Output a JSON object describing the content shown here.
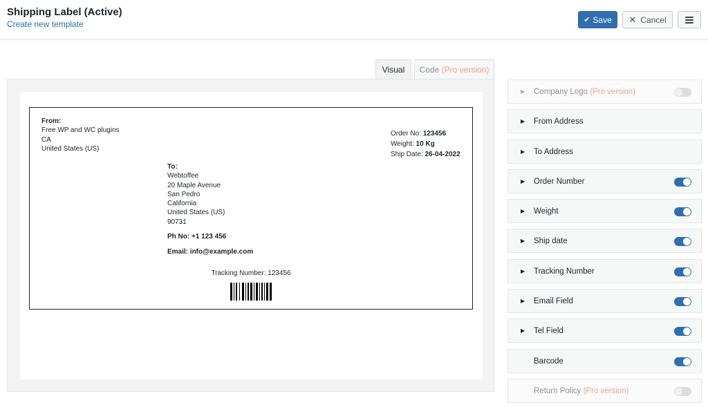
{
  "header": {
    "title": "Shipping Label (Active)",
    "create_link": "Create new template",
    "save_label": "Save",
    "cancel_label": "Cancel"
  },
  "tabs": {
    "visual": "Visual",
    "code": "Code",
    "code_pro": "(Pro version)"
  },
  "label": {
    "from_heading": "From:",
    "from_lines": [
      "Free WP and WC plugins",
      "CA",
      "United States (US)"
    ],
    "order_no_label": "Order No:",
    "order_no": "123456",
    "weight_label": "Weight:",
    "weight": "10 Kg",
    "ship_date_label": "Ship Date:",
    "ship_date": "26-04-2022",
    "to_heading": "To:",
    "to_lines": [
      "Webtoffee",
      "20 Maple Avenue",
      "San Pedro",
      "California",
      "United States (US)",
      "90731"
    ],
    "phone": "Ph No: +1 123 456",
    "email": "Email: info@example.com",
    "tracking": "Tracking Number: 123456"
  },
  "fields": [
    {
      "label": "Company Logo",
      "pro": "(Pro version)",
      "disabled": true,
      "arrow": true,
      "toggle": "off"
    },
    {
      "label": "From Address",
      "arrow": true,
      "toggle": "none"
    },
    {
      "label": "To Address",
      "arrow": true,
      "toggle": "none"
    },
    {
      "label": "Order Number",
      "arrow": true,
      "toggle": "on"
    },
    {
      "label": "Weight",
      "arrow": true,
      "toggle": "on"
    },
    {
      "label": "Ship date",
      "arrow": true,
      "toggle": "on"
    },
    {
      "label": "Tracking Number",
      "arrow": true,
      "toggle": "on"
    },
    {
      "label": "Email Field",
      "arrow": true,
      "toggle": "on"
    },
    {
      "label": "Tel Field",
      "arrow": true,
      "toggle": "on"
    },
    {
      "label": "Barcode",
      "arrow": false,
      "toggle": "on"
    },
    {
      "label": "Return Policy",
      "pro": "(Pro version)",
      "disabled": true,
      "arrow": false,
      "toggle": "off"
    }
  ],
  "colors": {
    "accent": "#2f6fb0",
    "link": "#2271b1",
    "pro": "#f0a08a"
  },
  "icons": {
    "save": "checkmark-icon",
    "cancel": "close-icon",
    "menu": "hamburger-menu-icon",
    "expand": "triangle-right-icon"
  }
}
